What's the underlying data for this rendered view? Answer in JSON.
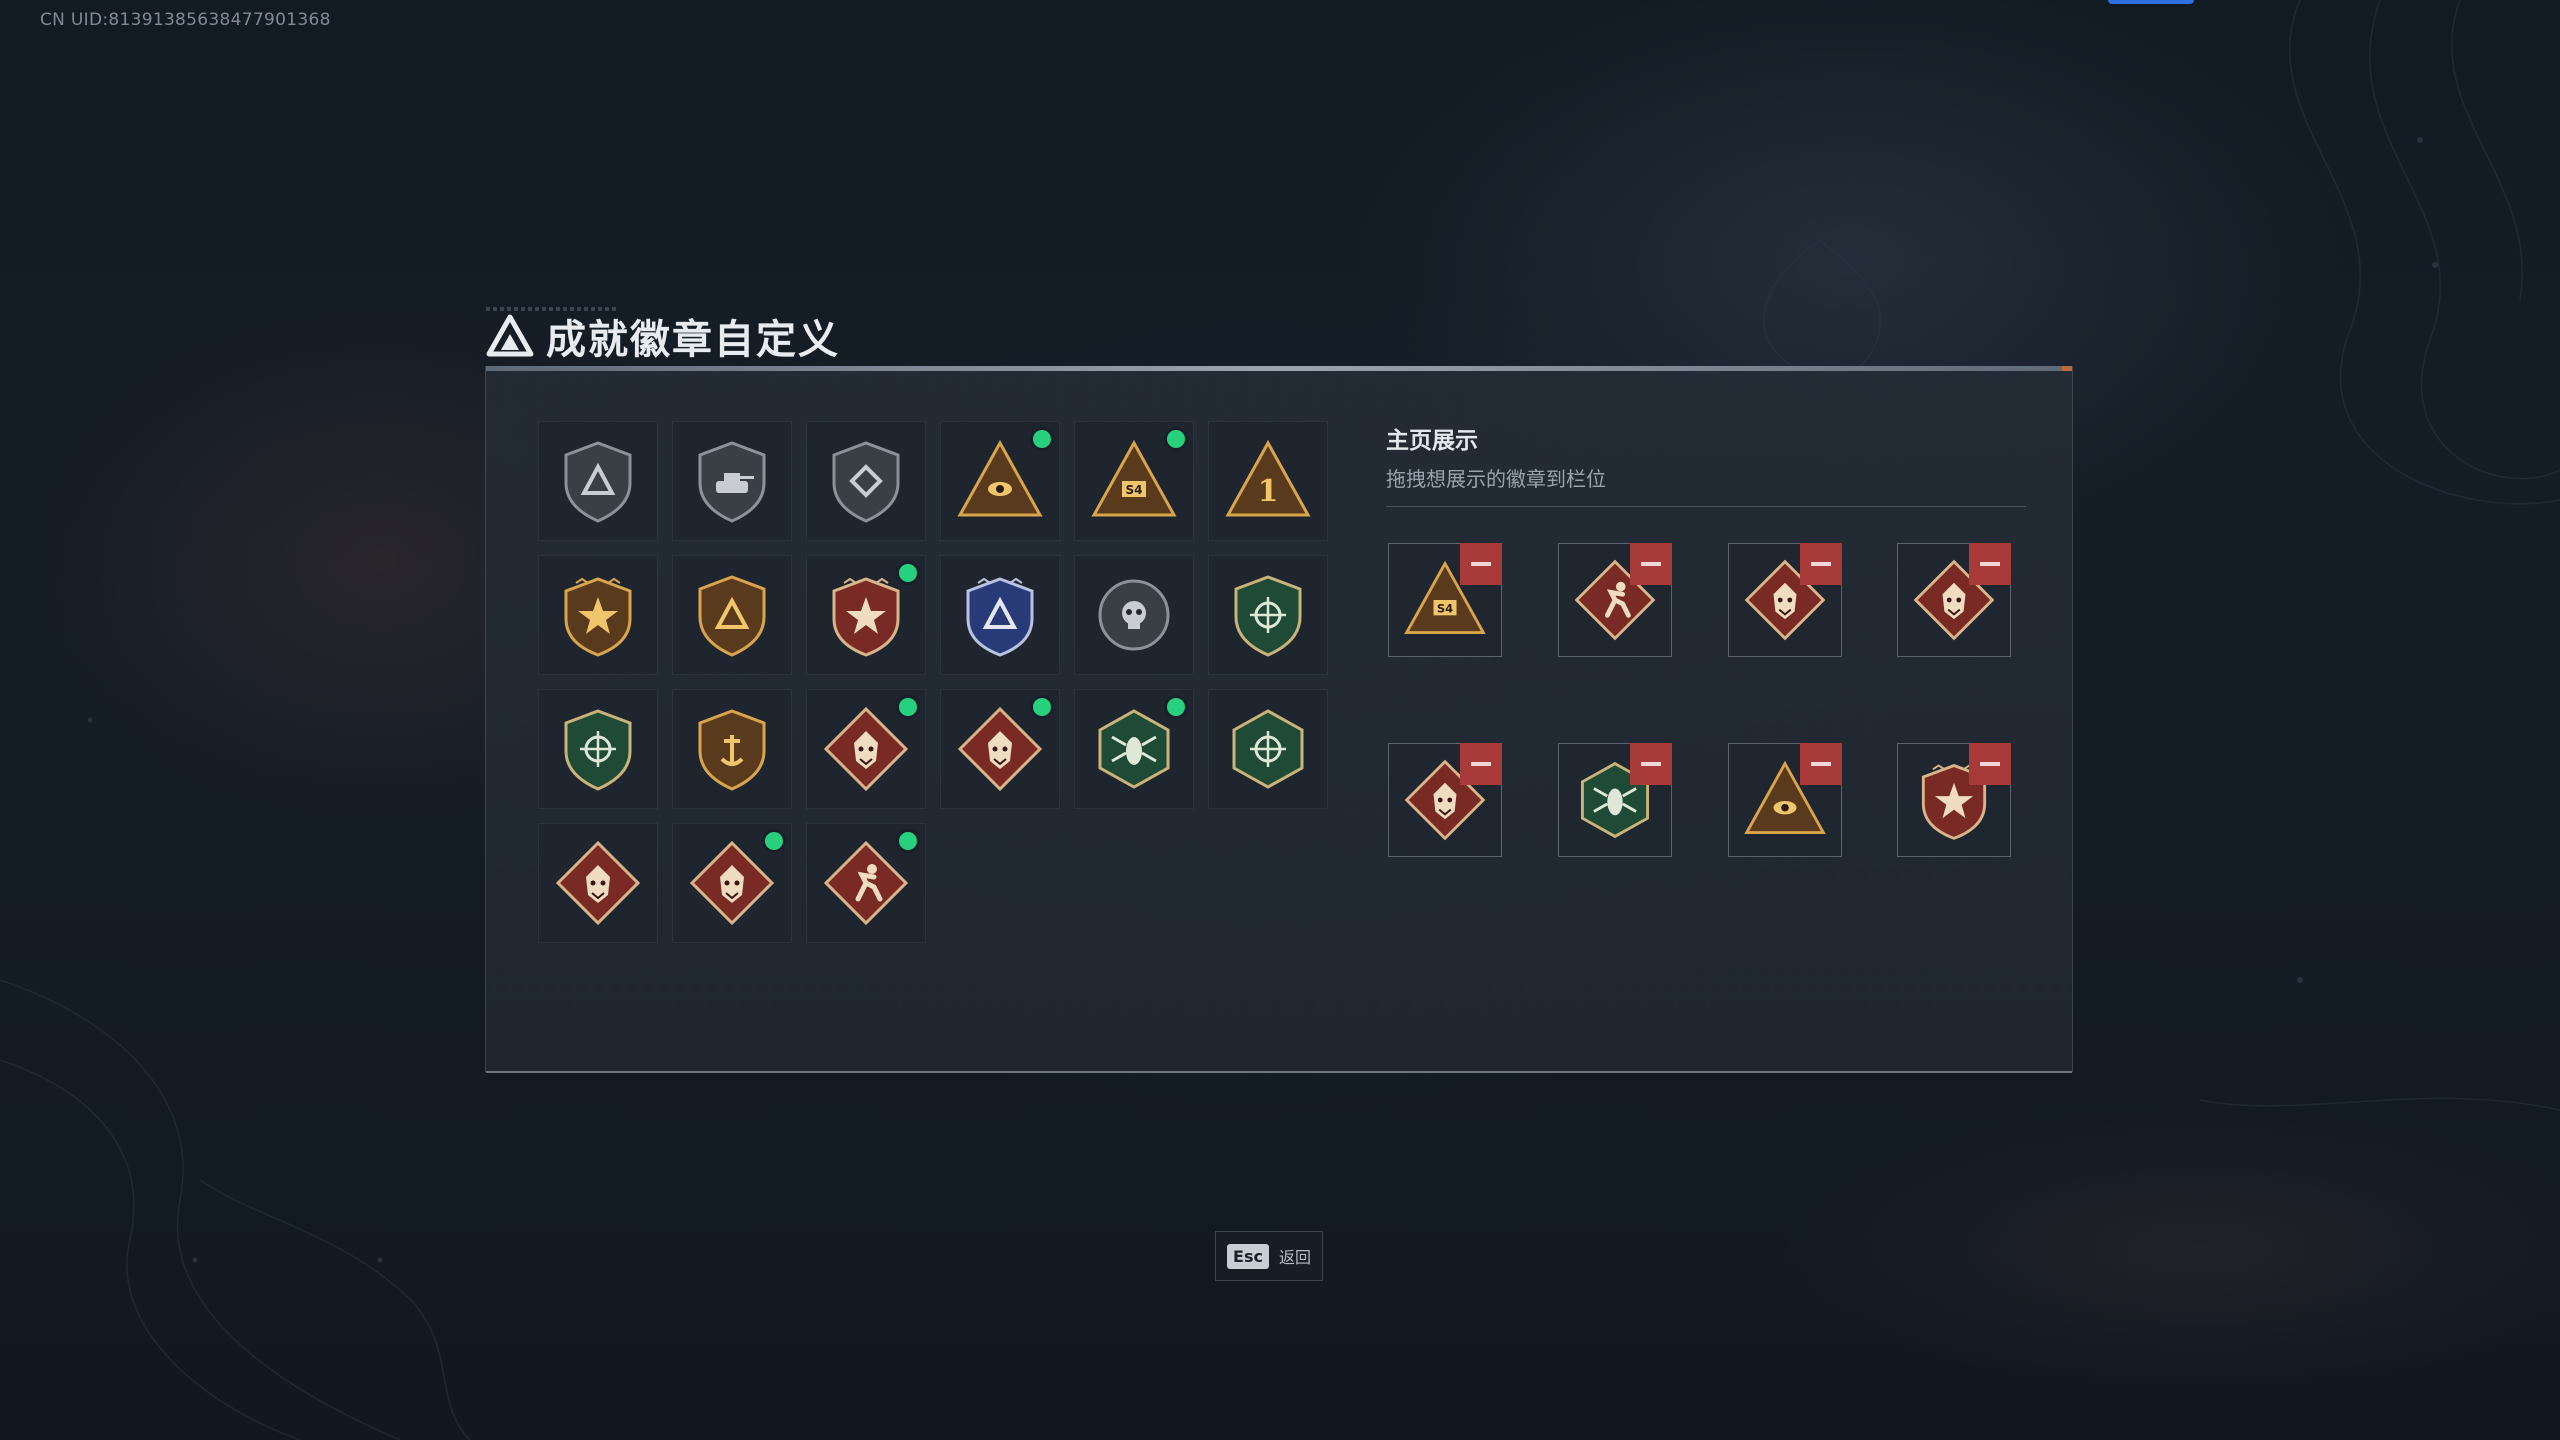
{
  "account": {
    "uid_text": "CN UID:8139138563847790136​8"
  },
  "page": {
    "title": "成就徽章自定义"
  },
  "showcase": {
    "title": "主页展示",
    "subtitle": "拖拽想展示的徽章到栏位"
  },
  "footer": {
    "esc_key": "Esc",
    "esc_label": "返回"
  },
  "colors": {
    "new_dot": "#26d07c",
    "remove_button": "#a83a3a",
    "accent_top": "#2f6de0"
  },
  "badges": [
    {
      "icon": "triangle-shield-badge-icon",
      "tone": "gray",
      "new": false
    },
    {
      "icon": "tank-shield-badge-icon",
      "tone": "gray",
      "new": false
    },
    {
      "icon": "diamond-shield-badge-icon",
      "tone": "gray",
      "new": false
    },
    {
      "icon": "eye-triangle-badge-icon",
      "tone": "gold",
      "new": true
    },
    {
      "icon": "s4-triangle-badge-icon",
      "tone": "gold",
      "new": true
    },
    {
      "icon": "number-one-triangle-badge-icon",
      "tone": "gold",
      "new": false
    },
    {
      "icon": "star-wreath-badge-icon",
      "tone": "gold",
      "new": false
    },
    {
      "icon": "winged-shield-badge-icon",
      "tone": "gold",
      "new": false
    },
    {
      "icon": "stars-crest-badge-icon",
      "tone": "red",
      "new": true
    },
    {
      "icon": "blue-crest-badge-icon",
      "tone": "blue",
      "new": false
    },
    {
      "icon": "skull-round-badge-icon",
      "tone": "gray",
      "new": false
    },
    {
      "icon": "rifle-green-shield-badge-icon",
      "tone": "green",
      "new": false
    },
    {
      "icon": "crosshair-green-shield-badge-icon",
      "tone": "green",
      "new": false
    },
    {
      "icon": "anchor-gold-shield-badge-icon",
      "tone": "gold",
      "new": false
    },
    {
      "icon": "wolf-diamond-badge-icon",
      "tone": "red",
      "new": true
    },
    {
      "icon": "wolf-diamond-badge-icon",
      "tone": "red",
      "new": true
    },
    {
      "icon": "hornet-hexagon-badge-icon",
      "tone": "green",
      "new": true
    },
    {
      "icon": "rifle-hexagon-badge-icon",
      "tone": "green",
      "new": false
    },
    {
      "icon": "dragon-diamond-badge-icon",
      "tone": "red",
      "new": false
    },
    {
      "icon": "dragon-diamond-badge-icon",
      "tone": "red",
      "new": true
    },
    {
      "icon": "runner-diamond-badge-icon",
      "tone": "red",
      "new": true
    }
  ],
  "showcase_slots": [
    {
      "icon": "s4-triangle-badge-icon",
      "tone": "gold"
    },
    {
      "icon": "runner-diamond-badge-icon",
      "tone": "red"
    },
    {
      "icon": "wolf-diamond-badge-icon",
      "tone": "red"
    },
    {
      "icon": "wolf-diamond-badge-icon",
      "tone": "red"
    },
    {
      "icon": "dragon-diamond-badge-icon",
      "tone": "red"
    },
    {
      "icon": "hornet-hexagon-badge-icon",
      "tone": "green"
    },
    {
      "icon": "eye-triangle-badge-icon",
      "tone": "gold"
    },
    {
      "icon": "stars-crest-badge-icon",
      "tone": "red"
    }
  ]
}
